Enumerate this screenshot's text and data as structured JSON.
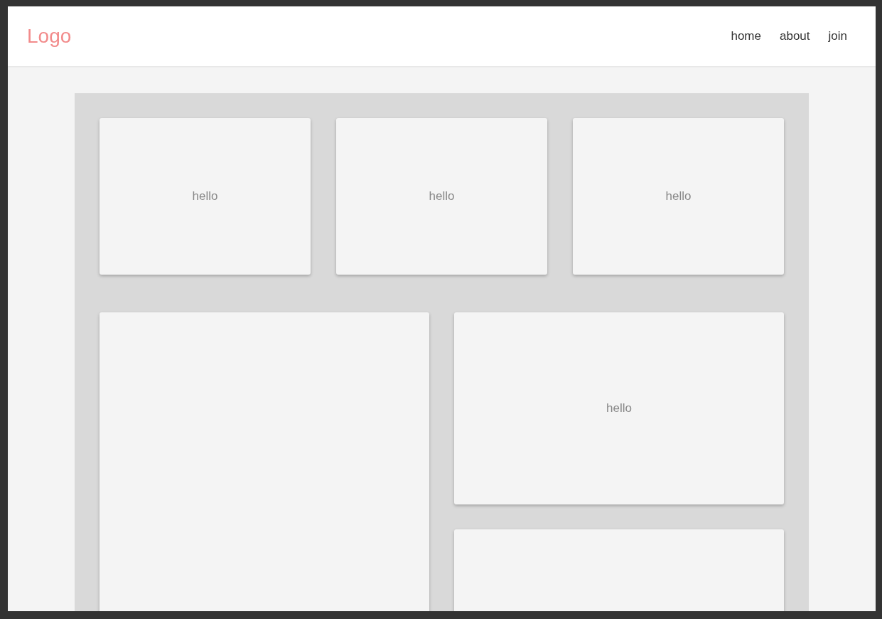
{
  "header": {
    "logo": "Logo",
    "nav": [
      {
        "label": "home"
      },
      {
        "label": "about"
      },
      {
        "label": "join"
      }
    ]
  },
  "top_cards": [
    {
      "text": "hello"
    },
    {
      "text": "hello"
    },
    {
      "text": "hello"
    }
  ],
  "bottom_cards": [
    {
      "kind": "tall"
    },
    {
      "kind": "short",
      "text": "hello"
    },
    {
      "kind": "short"
    }
  ]
}
